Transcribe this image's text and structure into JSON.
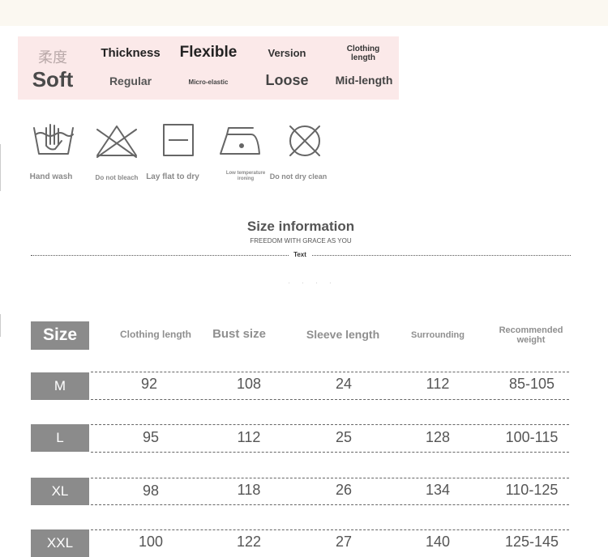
{
  "attributes": {
    "softness_cn": "柔度",
    "softness": "Soft",
    "thickness_label": "Thickness",
    "thickness": "Regular",
    "flex_label": "Flexible",
    "flex": "Micro-elastic",
    "version_label": "Version",
    "version": "Loose",
    "length_label": "Clothing length",
    "length": "Mid-length"
  },
  "care": [
    {
      "icon": "hand-wash-icon",
      "label": "Hand wash"
    },
    {
      "icon": "do-not-bleach-icon",
      "label": "Do not bleach"
    },
    {
      "icon": "lay-flat-to-dry-icon",
      "label": "Lay flat to dry"
    },
    {
      "icon": "low-temperature-ironing-icon",
      "label": "Low temperature ironing"
    },
    {
      "icon": "do-not-dry-clean-icon",
      "label": "Do not dry clean"
    }
  ],
  "size_info": {
    "title": "Size information",
    "subtitle": "FREEDOM WITH GRACE AS YOU",
    "mark": "Text"
  },
  "table": {
    "size_label": "Size",
    "headers": [
      "Clothing length",
      "Bust size",
      "Sleeve length",
      "Surrounding",
      "Recommended weight"
    ],
    "rows": [
      {
        "size": "M",
        "cells": [
          "92",
          "108",
          "24",
          "112",
          "85-105"
        ]
      },
      {
        "size": "L",
        "cells": [
          "95",
          "112",
          "25",
          "128",
          "100-115"
        ]
      },
      {
        "size": "XL",
        "cells": [
          "98",
          "118",
          "26",
          "134",
          "110-125"
        ]
      },
      {
        "size": "XXL",
        "cells": [
          "100",
          "122",
          "27",
          "140",
          "125-145"
        ]
      }
    ]
  },
  "colors": {
    "panel_bg": "#fbe9e9",
    "size_tag": "#8b8b8b",
    "top_strip": "#fbf8f1"
  }
}
